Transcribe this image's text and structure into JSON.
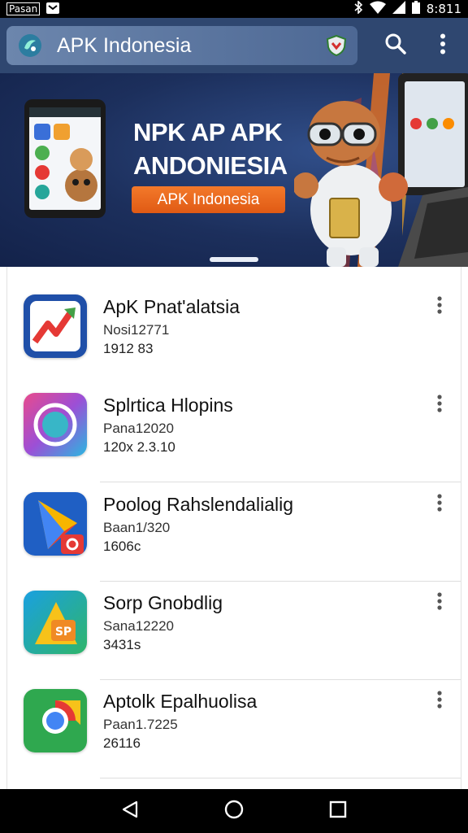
{
  "status_bar": {
    "carrier": "Pasan",
    "time": "8:811",
    "icons": [
      "message-icon",
      "bluetooth-icon",
      "wifi-icon",
      "signal-icon",
      "battery-icon"
    ]
  },
  "app_bar": {
    "title": "APK Indonesia",
    "icons": [
      "app-logo-icon",
      "shield-icon",
      "search-icon",
      "more-vert-icon"
    ],
    "colors": {
      "bar": "#2f4770",
      "pill": "#5c78a3"
    }
  },
  "banner": {
    "heading_line1": "NPK AP APK",
    "heading_line2": "ANDONIESIA",
    "cta_label": "APK Indonesia",
    "colors": {
      "background": "#1c2f5c",
      "cta": "#ec6a1e"
    }
  },
  "apps": [
    {
      "name": "ApK Pnat'alatsia",
      "meta1": "Nosi12771",
      "meta2": "1912 83",
      "icon": "trending-chart-icon"
    },
    {
      "name": "Splrtica Hlopins",
      "meta1": "Pana12020",
      "meta2": "120x 2.3.10",
      "icon": "ring-icon"
    },
    {
      "name": "Poolog Rahslendalialig",
      "meta1": "Baan1/320",
      "meta2": "1606c",
      "icon": "play-arrow-icon"
    },
    {
      "name": "Sorp Gnobdlig",
      "meta1": "Sana12220",
      "meta2": "3431s",
      "icon": "triangle-sp-icon"
    },
    {
      "name": "Aptolk Epalhuolisa",
      "meta1": "Paan1.7225",
      "meta2": "26116",
      "icon": "chrome-like-icon"
    }
  ],
  "nav_bar": {
    "icons": [
      "back-icon",
      "home-icon",
      "recents-icon"
    ]
  }
}
